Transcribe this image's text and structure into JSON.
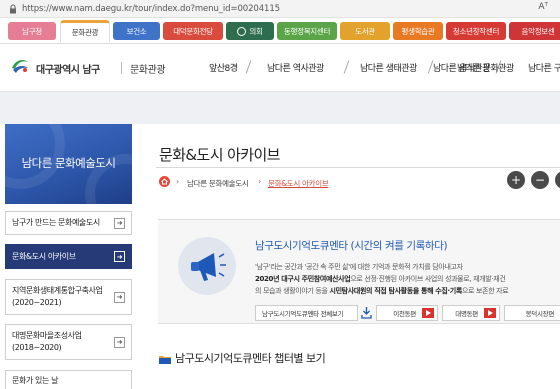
{
  "browser": {
    "url": "https://www.nam.daegu.kr/tour/index.do?menu_id=00204115",
    "reader_label": "Aᵀ"
  },
  "tabs": [
    {
      "label": "남구청",
      "color": "#e57e95"
    },
    {
      "label": "문화관광",
      "color": "#e8a33b"
    },
    {
      "label": "보건소",
      "color": "#3f73c8"
    },
    {
      "label": "대덕문화전당",
      "color": "#d94b3d"
    },
    {
      "label": "의회",
      "color": "#2e6e4e"
    },
    {
      "label": "동행정복지센터",
      "color": "#5ba548"
    },
    {
      "label": "도서관",
      "color": "#e2a22b"
    },
    {
      "label": "평생학습관",
      "color": "#e97a24"
    },
    {
      "label": "청소년창작센터",
      "color": "#d63a34"
    },
    {
      "label": "음악정보센",
      "color": "#cd3537"
    }
  ],
  "header": {
    "logo_text": "대구광역시 남구",
    "logo_sub": "문화관광",
    "menu": [
      "앞산8경",
      "남다른 역사관광",
      "남다른 생태관광",
      "남다른 음식관광",
      "남다른 문화관광",
      "남다른 구"
    ]
  },
  "sidebar": {
    "title": "남다른 문화예술도시",
    "items": [
      {
        "label": "남구가 만드는 문화예술도시",
        "active": false
      },
      {
        "label": "문화&도시 아카이브",
        "active": true
      },
      {
        "label": "지역문화생태계통합구축사업 (2020~2021)",
        "active": false
      },
      {
        "label": "대명문화마을조성사업 (2018~2020)",
        "active": false
      },
      {
        "label": "문화가 있는 날",
        "active": false
      }
    ]
  },
  "main": {
    "page_title": "문화&도시 아카이브",
    "breadcrumb": [
      "남다른 문화예술도시",
      "문화&도시 아카이브"
    ],
    "zoom_in": "+",
    "zoom_out": "−",
    "box": {
      "title": "남구도시기억도큐멘타 (시간의 켜를 기록하다)",
      "line1": "'남구'라는 공간과 '공간 속 주민 삶'에 대한 기억과 문화적 가치를 담아내고자",
      "line2_bold": "2020년 대구시 주민참여예산사업",
      "line2_rest": "으로 선정·진행된 아카이브 사업의 성과물로, 재개발·재건",
      "line3_pre": "의 모습과 생활이야기 등을 ",
      "line3_bold": "시민탐사대원의 직접 탐사활동을 통해 수집·기록",
      "line3_rest": "으로 보존한 자료"
    },
    "buttons": [
      "남구도시기억도큐멘타 전체보기",
      "이천동편",
      "대명동편",
      "봉덕시장편"
    ],
    "section_title": "남구도시기억도큐멘타 챕터별 보기"
  }
}
